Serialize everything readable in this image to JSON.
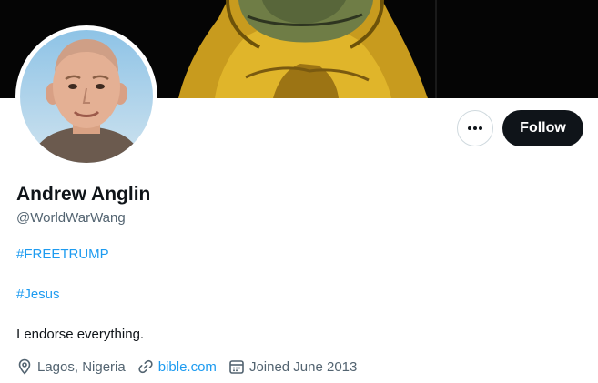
{
  "colors": {
    "accent": "#1d9bf0",
    "text_primary": "#0f1419",
    "text_secondary": "#536471",
    "button_dark": "#0f1419",
    "border": "#cfd9de"
  },
  "profile": {
    "display_name": "Andrew Anglin",
    "handle": "@WorldWarWang",
    "bio_lines": [
      "#FREETRUMP",
      "#Jesus",
      "I endorse everything."
    ],
    "location": "Lagos, Nigeria",
    "website": "bible.com",
    "joined": "Joined June 2013"
  },
  "actions": {
    "more_icon": "more-horizontal-icon",
    "follow_label": "Follow"
  },
  "icons": {
    "location": "location-pin-icon",
    "link": "link-icon",
    "calendar": "calendar-icon"
  }
}
